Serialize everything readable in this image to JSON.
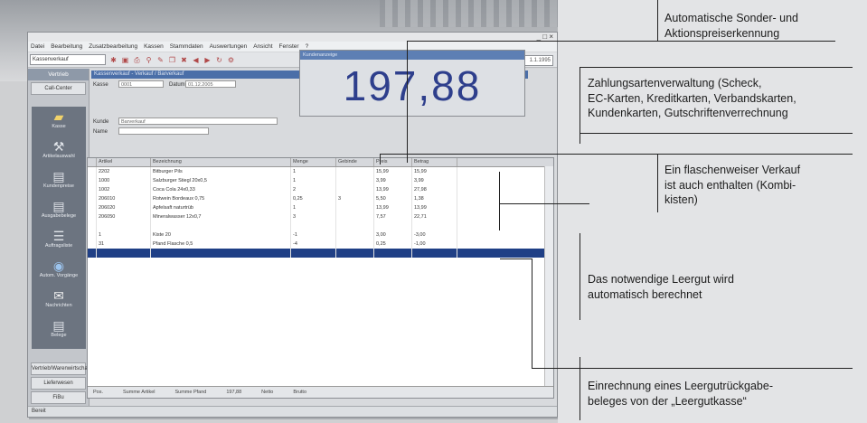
{
  "app": {
    "title_bar_controls": "_ □ ×",
    "menu": [
      "Datei",
      "Bearbeitung",
      "Zusatzbearbeitung",
      "Kassen",
      "Stammdaten",
      "Auswertungen",
      "Ansicht",
      "Fenster",
      "?"
    ],
    "toolbar_select": "Kassenverkauf",
    "toolbar_field": "1.1.1995",
    "sidebar": {
      "header": "Vertrieb",
      "top_button": "Call-Center",
      "items": [
        "Kasse",
        "Artikelauswahl",
        "Kundenpreise",
        "Ausgabebelege",
        "Auftragsliste",
        "Autom. Vorgänge",
        "Nachrichten",
        "Belege"
      ],
      "bottom_buttons": [
        "Vertrieb/Warenwirtschaft",
        "Lieferwesen",
        "FiBu"
      ]
    },
    "form": {
      "title": "Kassenverkauf - Verkauf / Barverkauf",
      "labels": [
        "Kasse",
        "Datum",
        "Kunde",
        "Name"
      ],
      "values": [
        "0001",
        "01.12.2005",
        "Barverkauf"
      ]
    },
    "display": {
      "header": "Kundenanzeige",
      "amount": "197,88"
    },
    "grid": {
      "columns": [
        "Artikel",
        "Bezeichnung",
        "Menge",
        "Gebinde",
        "Preis",
        "Betrag"
      ],
      "rows": [
        [
          "2202",
          "Bitburger Pils",
          "1",
          "",
          "15,99",
          "15,99"
        ],
        [
          "1000",
          "Salzburger Stiegl 20x0,5",
          "1",
          "",
          "3,99",
          "3,99"
        ],
        [
          "1002",
          "Coca Cola 24x0,33",
          "2",
          "",
          "13,99",
          "27,98"
        ],
        [
          "206010",
          "Rotwein Bordeaux 0,75",
          "0,25",
          "3",
          "5,50",
          "1,38"
        ],
        [
          "206020",
          "Apfelsaft naturtrüb",
          "1",
          "",
          "13,99",
          "13,99"
        ],
        [
          "206050",
          "Mineralwasser 12x0,7",
          "3",
          "",
          "7,57",
          "22,71"
        ],
        [
          "",
          "",
          "",
          "",
          "",
          ""
        ],
        [
          "1",
          "Kiste 20",
          "-1",
          "",
          "3,00",
          "-3,00"
        ],
        [
          "31",
          "Pfand Flasche 0,5",
          "-4",
          "",
          "0,25",
          "-1,00"
        ],
        [
          "",
          "",
          "",
          "",
          "",
          ""
        ]
      ],
      "footer": [
        "Pos.",
        "Summe Artikel",
        "Summe Pfand",
        "197,88",
        "Netto",
        "Brutto"
      ]
    },
    "statusbar": "Bereit"
  },
  "annotations": [
    "Automatische Sonder- und Aktionspreiserkennung",
    "Zahlungsartenverwaltung (Scheck, EC-Karten, Kreditkarten, Verbandskarten, Kundenkarten, Gutschriftenverrechnung",
    "Ein flaschenweiser Verkauf ist auch enthalten (Kombi-kisten)",
    "Das notwendige Leergut wird automatisch berechnet",
    "Einrechnung eines Leergutrückgabe-beleges von der „Leergutkasse“"
  ],
  "annotation_lines": [
    [
      "Automatische Sonder- und",
      "Aktionspreiserkennung"
    ],
    [
      "Zahlungsartenverwaltung (Scheck,",
      "EC-Karten, Kreditkarten, Verbandskarten,",
      "Kundenkarten, Gutschriftenverrechnung"
    ],
    [
      "Ein flaschenweiser Verkauf",
      "ist auch enthalten (Kombi-",
      "kisten)"
    ],
    [
      "Das notwendige Leergut wird",
      "automatisch berechnet"
    ],
    [
      "Einrechnung eines Leergutrückgabe-",
      "beleges von der „Leergutkasse“"
    ]
  ]
}
